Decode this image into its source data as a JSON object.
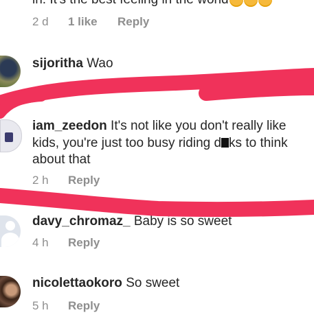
{
  "comments": [
    {
      "text": "in. It's the best feeling in the world",
      "time": "2 d",
      "likes": "1 like",
      "reply": "Reply"
    },
    {
      "username": "sijoritha",
      "text": "Wao"
    },
    {
      "username": "iam_zeedon",
      "text": "It's not like you don't really like kids, you're just too busy riding d",
      "text_end": "ks to think about that",
      "time": "2 h",
      "reply": "Reply"
    },
    {
      "username": "davy_chromaz_",
      "text": "Baby is so sweet",
      "time": "4 h",
      "reply": "Reply"
    },
    {
      "username": "nicolettaokoro",
      "text": "So sweet",
      "time": "5 h",
      "reply": "Reply"
    }
  ],
  "annotation": {
    "color": "#f0325a"
  },
  "icons": [
    "smiling-face-emoji-icon",
    "redaction-block-icon"
  ]
}
